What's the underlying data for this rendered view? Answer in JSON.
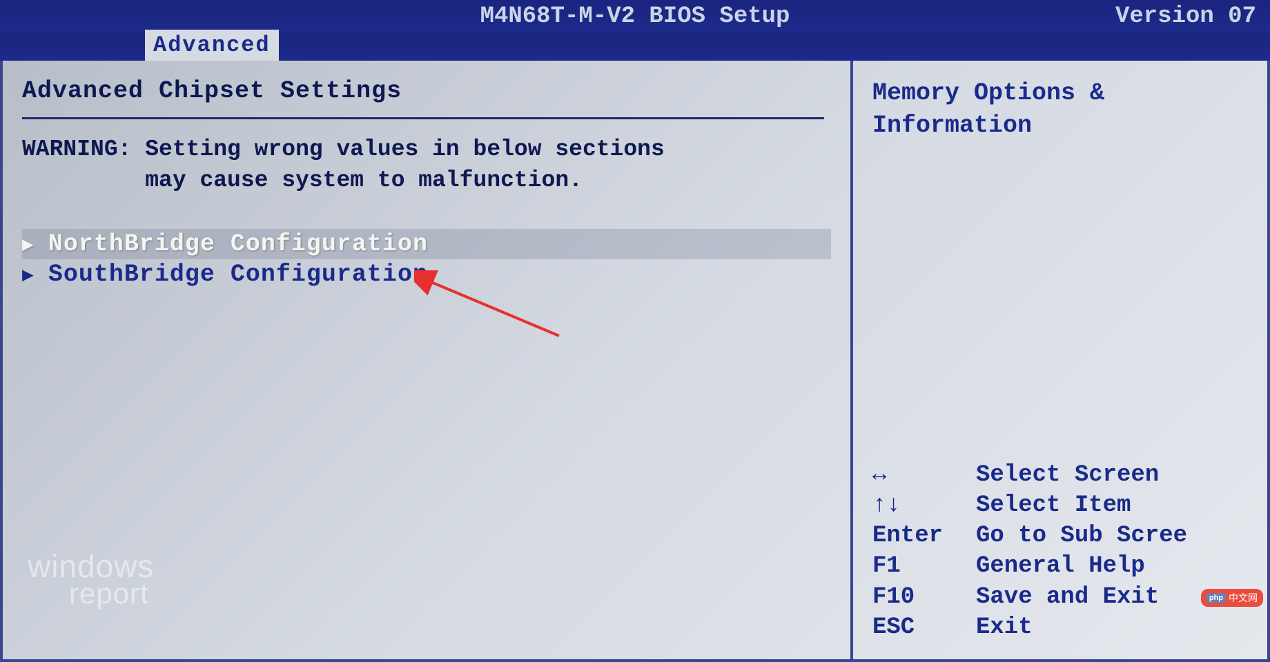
{
  "header": {
    "title": "M4N68T-M-V2 BIOS Setup",
    "version": "Version 07"
  },
  "tab": {
    "label": "Advanced"
  },
  "main": {
    "section_title": "Advanced Chipset Settings",
    "warning_label": "WARNING: ",
    "warning_line1": "Setting wrong values in below sections",
    "warning_line2": "may cause system to malfunction.",
    "items": [
      {
        "label": "NorthBridge Configuration",
        "selected": true
      },
      {
        "label": "SouthBridge Configuration",
        "selected": false
      }
    ]
  },
  "side": {
    "help_line1": "Memory Options &",
    "help_line2": "Information",
    "keys": [
      {
        "key": "↔",
        "action": "Select Screen"
      },
      {
        "key": "↑↓",
        "action": "Select Item"
      },
      {
        "key": "Enter",
        "action": "Go to Sub Scree"
      },
      {
        "key": "F1",
        "action": "General Help"
      },
      {
        "key": "F10",
        "action": "Save and Exit"
      },
      {
        "key": "ESC",
        "action": "Exit"
      }
    ]
  },
  "watermark": {
    "left_line1": "windows",
    "left_line2": "report",
    "right": "中文网"
  }
}
